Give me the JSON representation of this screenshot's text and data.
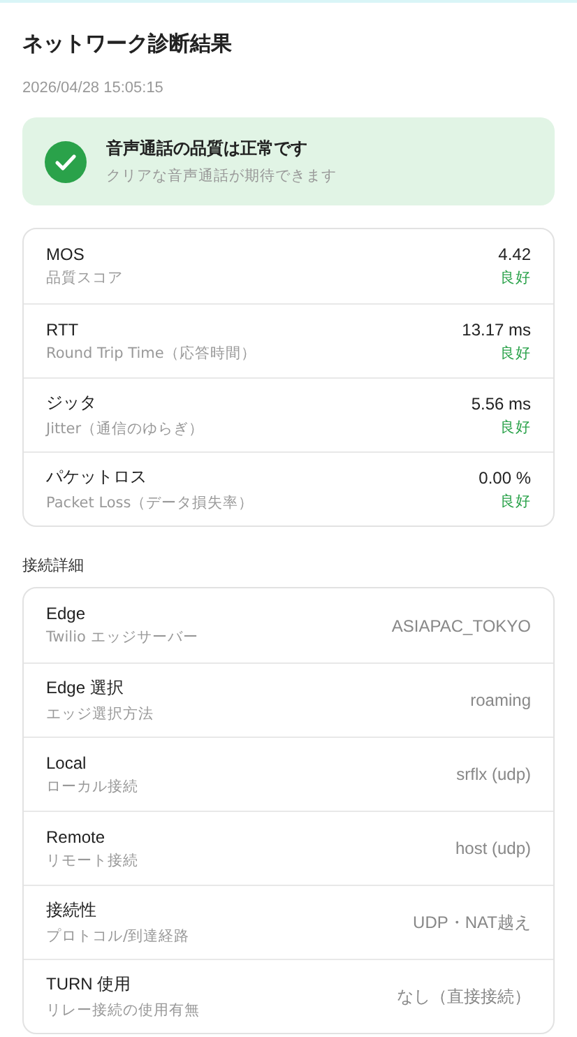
{
  "title": "ネットワーク診断結果",
  "timestamp": "2026/04/28 15:05:15",
  "summary": {
    "kind": "success",
    "headline": "音声通話の品質は正常です",
    "detail": "クリアな音声通話が期待できます"
  },
  "metrics": [
    {
      "name": "MOS",
      "description": "品質スコア",
      "value": "4.42",
      "rating": "良好",
      "color": "#2aa24a"
    },
    {
      "name": "RTT",
      "description": "Round Trip Time（応答時間）",
      "value": "13.17 ms",
      "rating": "良好",
      "color": "#2aa24a"
    },
    {
      "name": "ジッタ",
      "description": "Jitter（通信のゆらぎ）",
      "value": "5.56 ms",
      "rating": "良好",
      "color": "#2aa24a"
    },
    {
      "name": "パケットロス",
      "description": "Packet Loss（データ損失率）",
      "value": "0.00 %",
      "rating": "良好",
      "color": "#2aa24a"
    }
  ],
  "details_heading": "接続詳細",
  "details": [
    {
      "name": "Edge",
      "description": "Twilio エッジサーバー",
      "value": "ASIAPAC_TOKYO"
    },
    {
      "name": "Edge 選択",
      "description": "エッジ選択方法",
      "value": "roaming"
    },
    {
      "name": "Local",
      "description": "ローカル接続",
      "value": "srflx (udp)"
    },
    {
      "name": "Remote",
      "description": "リモート接続",
      "value": "host (udp)"
    },
    {
      "name": "接続性",
      "description": "プロトコル/到達経路",
      "value": "UDP・NAT越え"
    },
    {
      "name": "TURN 使用",
      "description": "リレー接続の使用有無",
      "value": "なし（直接接続）"
    }
  ]
}
